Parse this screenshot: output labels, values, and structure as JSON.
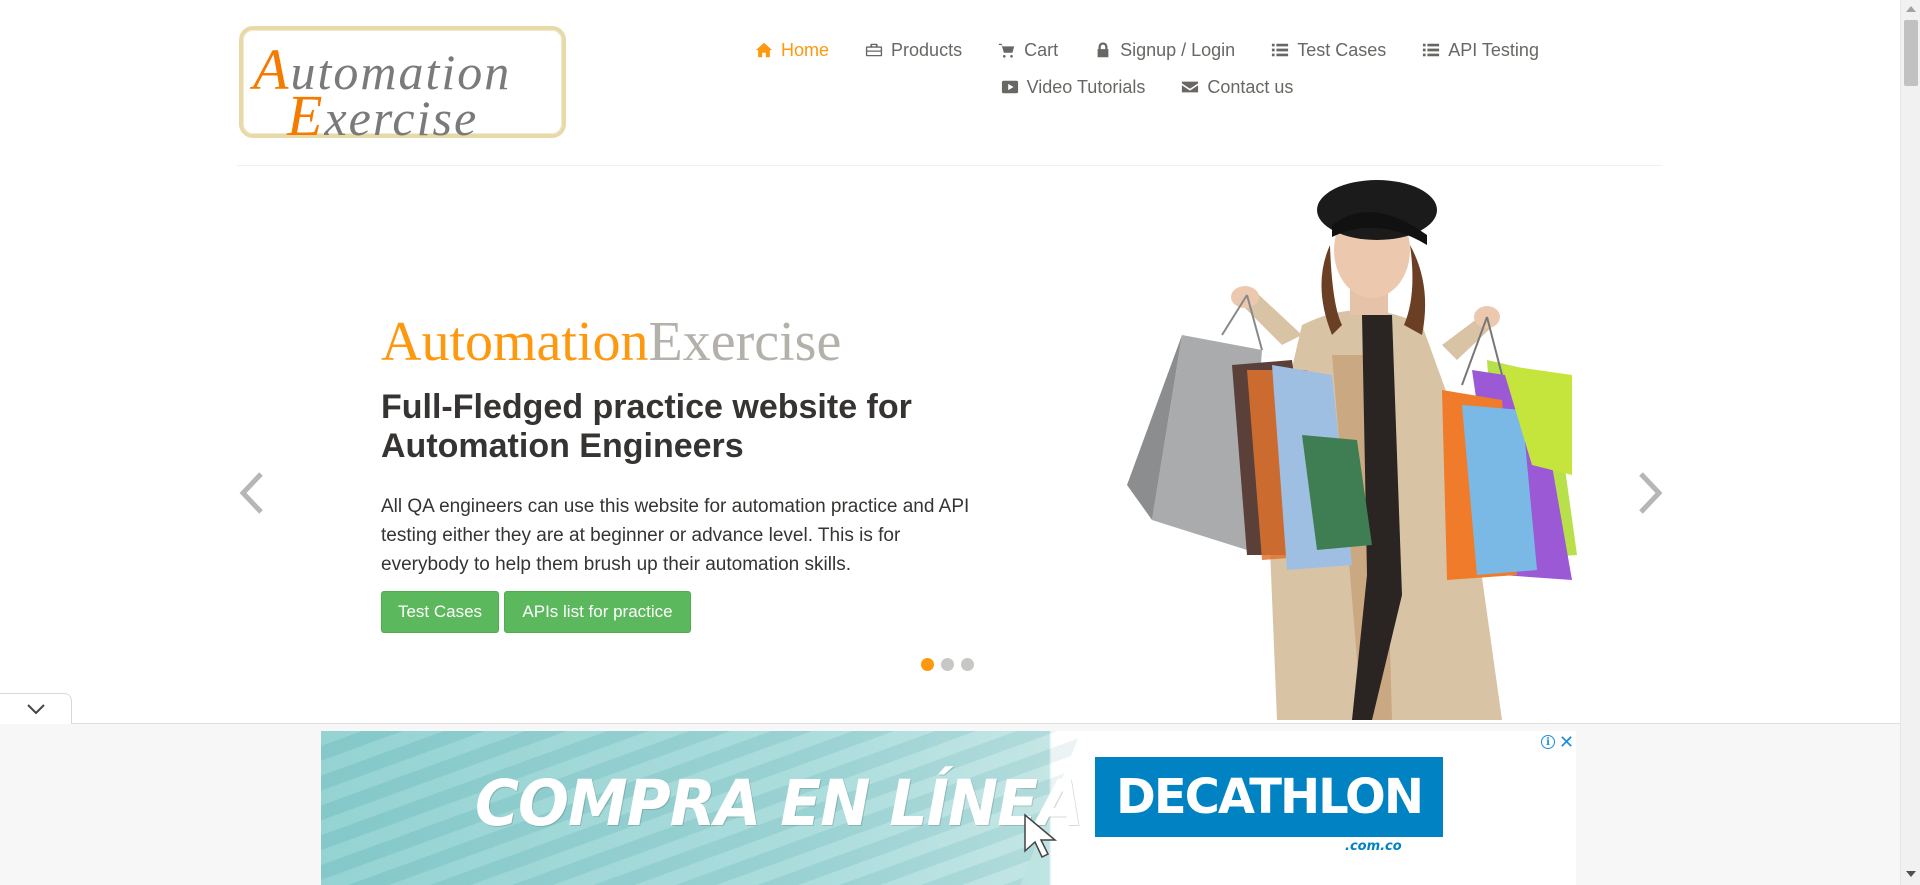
{
  "logo": {
    "line1_cap": "A",
    "line1_rest": "utomation",
    "line2_cap": "E",
    "line2_rest": "xercise"
  },
  "nav": {
    "row1": [
      {
        "label": "Home",
        "icon": "home-icon",
        "active": true
      },
      {
        "label": "Products",
        "icon": "briefcase-icon",
        "active": false
      },
      {
        "label": "Cart",
        "icon": "cart-icon",
        "active": false
      },
      {
        "label": "Signup / Login",
        "icon": "lock-icon",
        "active": false
      },
      {
        "label": "Test Cases",
        "icon": "list-icon",
        "active": false
      },
      {
        "label": "API Testing",
        "icon": "list-icon",
        "active": false
      }
    ],
    "row2": [
      {
        "label": "Video Tutorials",
        "icon": "youtube-icon",
        "active": false
      },
      {
        "label": "Contact us",
        "icon": "envelope-icon",
        "active": false
      }
    ]
  },
  "slider": {
    "brand_a": "Automation",
    "brand_b": "Exercise",
    "headline": "Full-Fledged practice website for Automation Engineers",
    "description": "All QA engineers can use this website for automation practice and API testing either they are at beginner or advance level. This is for everybody to help them brush up their automation skills.",
    "button_test_cases": "Test Cases",
    "button_apis": "APIs list for practice",
    "active_slide": 1,
    "slide_count": 3
  },
  "ad": {
    "headline": "COMPRA EN LÍNEA",
    "brand": "DECATHLON",
    "domain": ".com.co"
  },
  "colors": {
    "accent": "#fe980f",
    "button_green": "#5cb85c",
    "text_dark": "#363432",
    "text_muted": "#696763"
  }
}
